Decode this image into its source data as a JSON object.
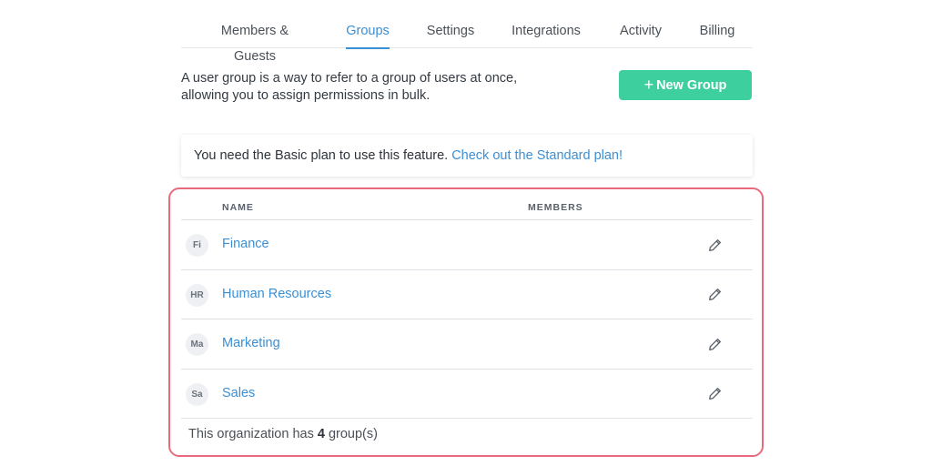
{
  "tabs": [
    {
      "label": "Members & Guests",
      "active": false
    },
    {
      "label": "Groups",
      "active": true
    },
    {
      "label": "Settings",
      "active": false
    },
    {
      "label": "Integrations",
      "active": false
    },
    {
      "label": "Activity",
      "active": false
    },
    {
      "label": "Billing",
      "active": false
    }
  ],
  "intro": {
    "line1": "A user group is a way to refer to a group of users at once,",
    "line2": "allowing you to assign permissions in bulk."
  },
  "new_group_button": {
    "icon": "plus-icon",
    "label": "New Group"
  },
  "notice": {
    "text": "You need the Basic plan to use this feature.",
    "link": "Check out the Standard plan!"
  },
  "table": {
    "headers": {
      "name": "NAME",
      "members": "MEMBERS"
    },
    "rows": [
      {
        "initials": "Fi",
        "name": "Finance",
        "edit_icon": "pencil-icon"
      },
      {
        "initials": "HR",
        "name": "Human Resources",
        "edit_icon": "pencil-icon"
      },
      {
        "initials": "Ma",
        "name": "Marketing",
        "edit_icon": "pencil-icon"
      },
      {
        "initials": "Sa",
        "name": "Sales",
        "edit_icon": "pencil-icon"
      }
    ]
  },
  "footer": {
    "prefix": "This organization has",
    "count": "4",
    "suffix": "group(s)"
  },
  "colors": {
    "accent": "#3b8fd4",
    "button": "#3ecf9e",
    "highlight": "#e86a7c"
  }
}
